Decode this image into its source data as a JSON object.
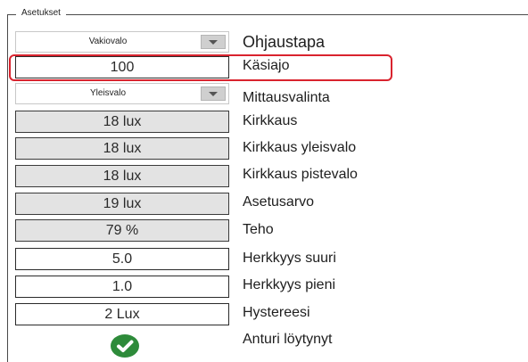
{
  "group": {
    "legend": "Asetukset"
  },
  "rows": {
    "ohjaustapa": {
      "value": "Vakiovalo",
      "label": "Ohjaustapa"
    },
    "kasiajo": {
      "value": "100",
      "label": "Käsiajo"
    },
    "mittausvalinta": {
      "value": "Yleisvalo",
      "label": "Mittausvalinta"
    },
    "kirkkaus": {
      "value": "18 lux",
      "label": "Kirkkaus"
    },
    "kirkkaus_yleisvalo": {
      "value": "18 lux",
      "label": "Kirkkaus yleisvalo"
    },
    "kirkkaus_pistevalo": {
      "value": "18 lux",
      "label": "Kirkkaus pistevalo"
    },
    "asetusarvo": {
      "value": "19 lux",
      "label": "Asetusarvo"
    },
    "teho": {
      "value": "79 %",
      "label": "Teho"
    },
    "herkkyys_suuri": {
      "value": "5.0",
      "label": "Herkkyys suuri"
    },
    "herkkyys_pieni": {
      "value": "1.0",
      "label": "Herkkyys pieni"
    },
    "hystereesi": {
      "value": "2 Lux",
      "label": "Hystereesi"
    },
    "anturi": {
      "icon": "check-circle-icon",
      "label": "Anturi löytynyt"
    }
  },
  "colors": {
    "highlight": "#d9232e",
    "check": "#2e8b3a",
    "readonly_bg": "#e3e3e3"
  }
}
